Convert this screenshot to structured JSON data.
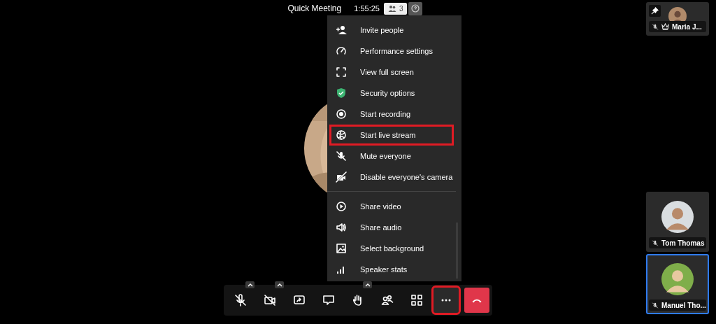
{
  "header": {
    "title": "Quick Meeting",
    "timer": "1:55:25",
    "participant_count": "3"
  },
  "menu": {
    "sections": [
      [
        {
          "label": "Invite people",
          "highlighted": false
        },
        {
          "label": "Performance settings",
          "highlighted": false
        },
        {
          "label": "View full screen",
          "highlighted": false
        },
        {
          "label": "Security options",
          "highlighted": false
        },
        {
          "label": "Start recording",
          "highlighted": false
        },
        {
          "label": "Start live stream",
          "highlighted": true
        },
        {
          "label": "Mute everyone",
          "highlighted": false
        },
        {
          "label": "Disable everyone's camera",
          "highlighted": false
        }
      ],
      [
        {
          "label": "Share video",
          "highlighted": false
        },
        {
          "label": "Share audio",
          "highlighted": false
        },
        {
          "label": "Select background",
          "highlighted": false
        },
        {
          "label": "Speaker stats",
          "highlighted": false
        }
      ]
    ]
  },
  "toolbar": {
    "buttons": [
      {
        "kind": "tool",
        "has_caret": true,
        "highlighted": false
      },
      {
        "kind": "tool",
        "has_caret": true,
        "highlighted": false
      },
      {
        "kind": "tool",
        "has_caret": false,
        "highlighted": false
      },
      {
        "kind": "tool",
        "has_caret": false,
        "highlighted": false
      },
      {
        "kind": "tool",
        "has_caret": true,
        "highlighted": false
      },
      {
        "kind": "tool",
        "has_caret": false,
        "highlighted": false
      },
      {
        "kind": "tool",
        "has_caret": false,
        "highlighted": false
      },
      {
        "kind": "tool",
        "has_caret": false,
        "highlighted": true
      },
      {
        "kind": "hangup",
        "has_caret": false,
        "highlighted": false
      }
    ]
  },
  "filmstrip": {
    "tiles": [
      {
        "kind": "local",
        "name": "Maria J...",
        "muted": true,
        "moderator": true,
        "pinned": true,
        "selected": false
      },
      {
        "kind": "remote",
        "name": "Tom Thomas",
        "muted": true,
        "moderator": false,
        "pinned": false,
        "selected": false
      },
      {
        "kind": "remote",
        "name": "Manuel Tho...",
        "muted": true,
        "moderator": false,
        "pinned": false,
        "selected": true
      }
    ]
  }
}
